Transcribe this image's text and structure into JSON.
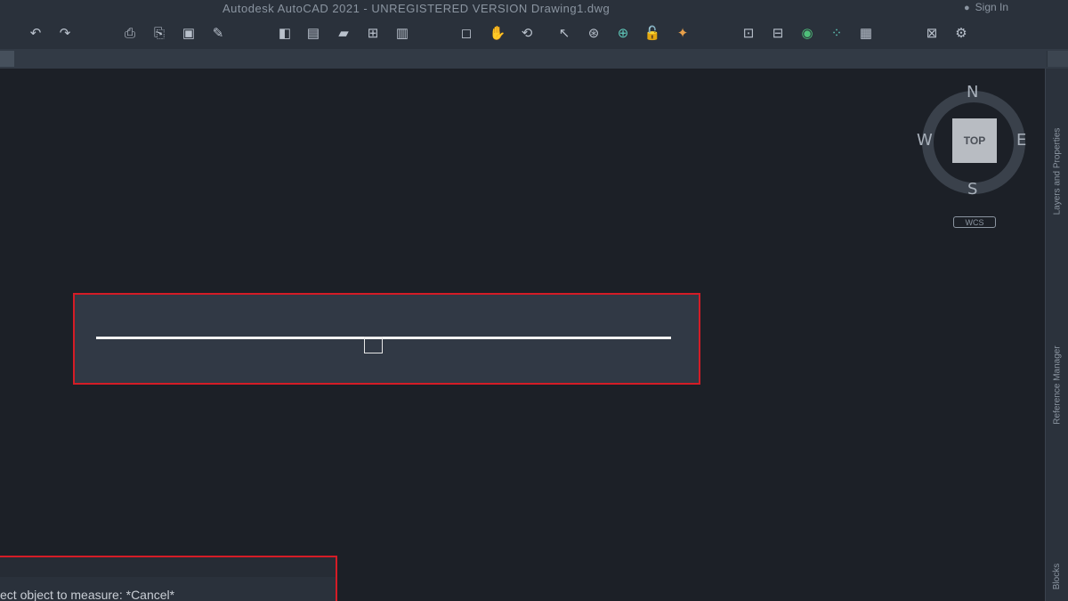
{
  "window": {
    "title": "Autodesk AutoCAD 2021 - UNREGISTERED VERSION   Drawing1.dwg",
    "sign_in": "Sign In"
  },
  "toolbar": {
    "buttons": [
      {
        "name": "undo",
        "glyph": "↶"
      },
      {
        "name": "redo",
        "glyph": "↷"
      },
      {
        "name": "plot",
        "glyph": "⎙"
      },
      {
        "name": "batch-plot",
        "glyph": "⎘"
      },
      {
        "name": "save",
        "glyph": "▣"
      },
      {
        "name": "save-as",
        "glyph": "✎"
      },
      {
        "name": "layers",
        "glyph": "◧"
      },
      {
        "name": "properties",
        "glyph": "▤"
      },
      {
        "name": "open-folder",
        "glyph": "▰"
      },
      {
        "name": "design-center",
        "glyph": "⊞"
      },
      {
        "name": "tool-palettes",
        "glyph": "▥"
      },
      {
        "name": "select",
        "glyph": "◻"
      },
      {
        "name": "pan",
        "glyph": "✋"
      },
      {
        "name": "orbit",
        "glyph": "⟲"
      },
      {
        "name": "measure",
        "glyph": "↖"
      },
      {
        "name": "object-snap",
        "glyph": "⊛"
      },
      {
        "name": "zoom",
        "glyph": "⊕"
      },
      {
        "name": "lock",
        "glyph": "🔓"
      },
      {
        "name": "markup",
        "glyph": "✦"
      },
      {
        "name": "block",
        "glyph": "⊡"
      },
      {
        "name": "insert",
        "glyph": "⊟"
      },
      {
        "name": "globe",
        "glyph": "◉"
      },
      {
        "name": "nodes",
        "glyph": "⁘"
      },
      {
        "name": "sheet-set",
        "glyph": "▦"
      },
      {
        "name": "camera",
        "glyph": "⊠"
      },
      {
        "name": "settings",
        "glyph": "⚙"
      }
    ]
  },
  "viewcube": {
    "face": "TOP",
    "north": "N",
    "south": "S",
    "east": "E",
    "west": "W",
    "wcs_label": "WCS"
  },
  "palette": {
    "tabs": [
      "Layers and Properties",
      "Reference Manager",
      "Blocks"
    ]
  },
  "command_line": {
    "text": "ect object to measure: *Cancel*"
  },
  "colors": {
    "background": "#1c2027",
    "toolbar": "#2a313b",
    "highlight_border": "#d41c26",
    "line": "#f2f2f2"
  }
}
